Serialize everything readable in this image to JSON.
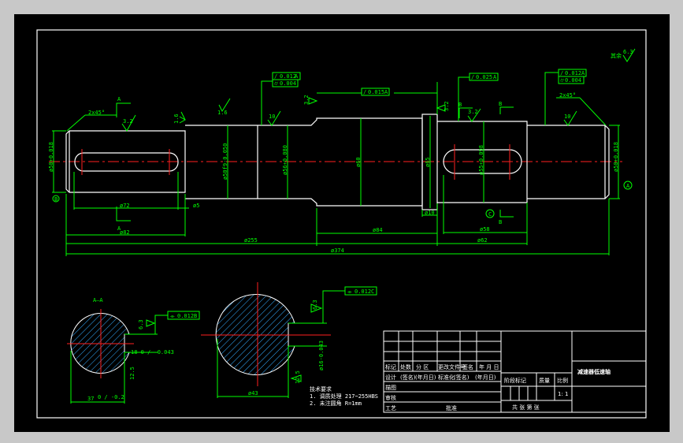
{
  "colors": {
    "background": "#000000",
    "outline": "#ffffff",
    "dimension": "#00ff00",
    "centerline": "#ff2020",
    "hatch": "#33aaff"
  },
  "main_view": {
    "tolerance_frames": [
      {
        "rows": [
          [
            "/",
            "0.012",
            "A"
          ],
          [
            "⌭",
            "0.004"
          ]
        ]
      },
      {
        "rows": [
          [
            "/",
            "0.015",
            "A"
          ]
        ]
      },
      {
        "rows": [
          [
            "/",
            "0.025",
            "A"
          ]
        ]
      },
      {
        "rows": [
          [
            "/",
            "0.012",
            "A"
          ],
          [
            "⌭",
            "0.004"
          ]
        ]
      }
    ],
    "dimensions": {
      "chamfer_left": "2x45°",
      "chamfer_right": "2x45°",
      "d72": "ø72",
      "d82": "ø82",
      "d5": "ø5",
      "d255": "ø255",
      "d374": "ø374",
      "d84": "ø84",
      "d10": "ø10",
      "d58": "ø58",
      "d62": "ø62",
      "dia1": "ø50+0.018",
      "dia2": "ø50f9-0.050",
      "dia3": "ø56+0.080",
      "dia4": "ø60",
      "dia5": "ø65",
      "dia6": "ø55+0.098",
      "dia7": "ø50+0.018"
    },
    "roughness": {
      "r1": "3.2",
      "r2": "1.6",
      "r3": "10",
      "r4": "3.2",
      "r5": "3.2",
      "r6": "10",
      "r7": "3.2",
      "r8": "6.3",
      "other_label": "其余",
      "other_value": "6.3"
    },
    "section_labels": {
      "a_top": "A",
      "a_bottom": "A",
      "b_top": "B",
      "b_right": "B",
      "b_bottom": "B",
      "datum_a": "A",
      "datum_b": "B",
      "datum_c": "C"
    }
  },
  "section_aa": {
    "title": "A—A",
    "tolerance": [
      "⌯",
      "0.012",
      "B"
    ],
    "width": "37",
    "width_tol": "0 / -0.2",
    "key_width": "18 0 / -0.043",
    "roughness": "6.3",
    "roughness2": "12.5"
  },
  "section_c": {
    "tolerance": [
      "⌯",
      "0.012",
      "C"
    ],
    "diameter": "ø43",
    "key_width": "ø16-0.043",
    "roughness": "6.3",
    "roughness2": "12.5"
  },
  "tech_notes": {
    "title": "技术要求",
    "lines": [
      "1. 调质处理 217~255HBS",
      "2. 未注圆角 R=1mm"
    ]
  },
  "title_block": {
    "part_name": "减速器低速轴",
    "header_row": [
      "标记",
      "处数",
      "分 区",
      "更改文件号",
      "签名",
      "年 月 日"
    ],
    "design_row": [
      "设计",
      "(签名)",
      "(年月日)",
      "标准化",
      "(签名)",
      "(年月日)"
    ],
    "rows": [
      "描图",
      "审核",
      "工艺"
    ],
    "approve": "批准",
    "stage_mark": "阶段标记",
    "weight": "质量",
    "scale_label": "比例",
    "scale_value": "1: 1",
    "sheets": "共   张   第   张"
  }
}
